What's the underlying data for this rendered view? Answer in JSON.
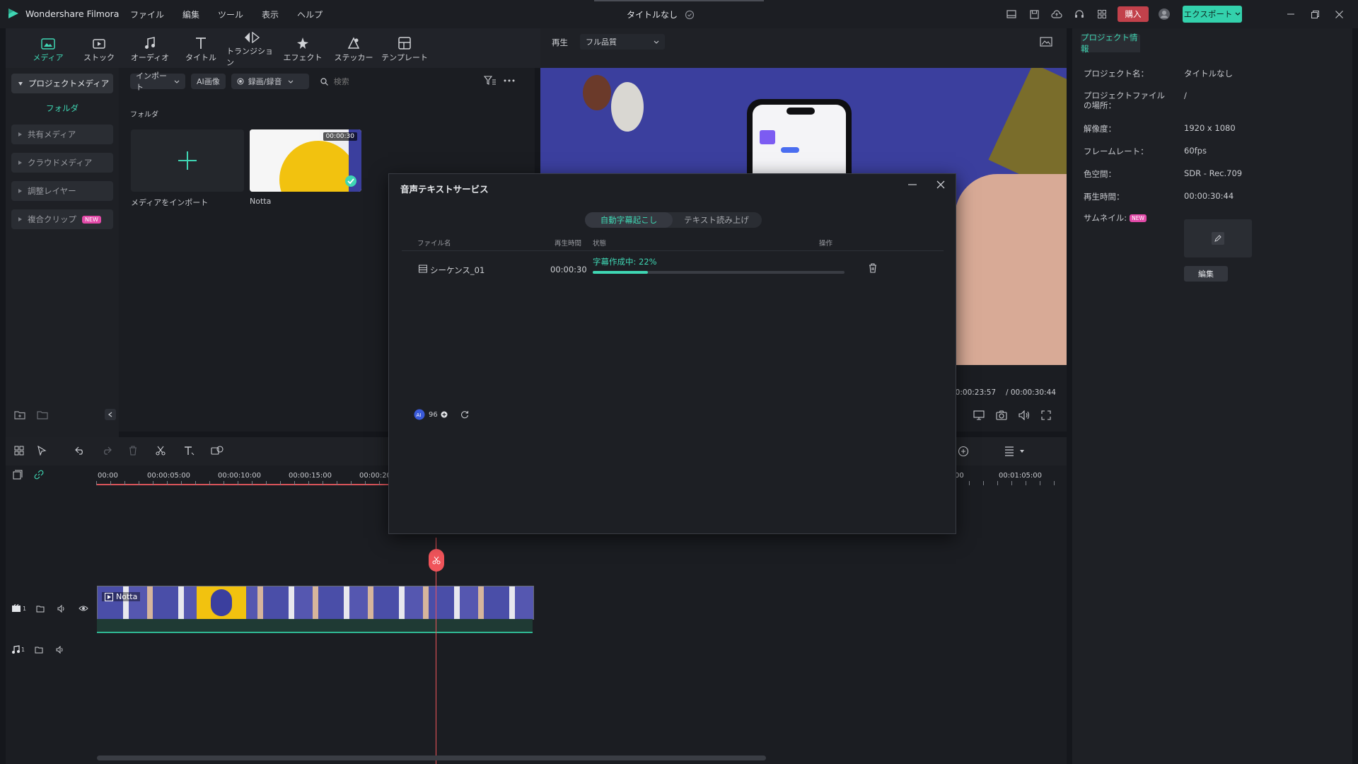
{
  "app": {
    "name": "Wondershare Filmora",
    "project_title": "タイトルなし",
    "menu": [
      "ファイル",
      "編集",
      "ツール",
      "表示",
      "ヘルプ"
    ],
    "buy_label": "購入",
    "export_label": "エクスポート"
  },
  "toolbar_tabs": [
    "メディア",
    "ストック",
    "オーディオ",
    "タイトル",
    "トランジション",
    "エフェクト",
    "ステッカー",
    "テンプレート"
  ],
  "media": {
    "sidebar": {
      "project_media": "プロジェクトメディア",
      "folder": "フォルダ",
      "shared_media": "共有メディア",
      "cloud_media": "クラウドメディア",
      "adjustment_layer": "調整レイヤー",
      "compound_clip": "複合クリップ",
      "new_badge": "NEW"
    },
    "import_label": "インポート",
    "ai_image_label": "AI画像",
    "record_label": "録画/録音",
    "search_placeholder": "検索",
    "folder_header": "フォルダ",
    "import_media_label": "メディアをインポート",
    "clip_name": "Notta",
    "clip_duration": "00:00:30"
  },
  "preview": {
    "play_label": "再生",
    "quality": "フル品質",
    "current_time": "00:00:23:57",
    "total_time": "/ 00:00:30:44"
  },
  "timeline": {
    "ticks": [
      "00:00",
      "00:00:05:00",
      "00:00:10:00",
      "00:00:15:00",
      "00:00:20",
      "00",
      "00:01:05:00"
    ],
    "clip_label": "Notta",
    "video_track_num": "1",
    "audio_track_num": "1"
  },
  "project_info": {
    "tab_label": "プロジェクト情報",
    "rows": [
      {
        "label": "プロジェクト名：",
        "value": "タイトルなし"
      },
      {
        "label": "プロジェクトファイルの場所：",
        "value": "/"
      },
      {
        "label": "解像度：",
        "value": "1920 x 1080"
      },
      {
        "label": "フレームレート：",
        "value": "60fps"
      },
      {
        "label": "色空間：",
        "value": "SDR - Rec.709"
      },
      {
        "label": "再生時間：",
        "value": "00:00:30:44"
      }
    ],
    "thumbnail_label": "サムネイル:",
    "new_badge": "NEW",
    "edit_label": "編集"
  },
  "dialog": {
    "title": "音声テキストサービス",
    "tab_active": "自動字幕起こし",
    "tab_inactive": "テキスト読み上げ",
    "col_filename": "ファイル名",
    "col_duration": "再生時間",
    "col_status": "状態",
    "col_action": "操作",
    "row_filename": "シーケンス_01",
    "row_duration": "00:00:30",
    "row_status": "字幕作成中:  22%",
    "progress": 0.22,
    "credits": "96"
  },
  "colors": {
    "accent": "#3fd6b3",
    "playhead": "#f0545a",
    "buy": "#c2414b",
    "export": "#33d1ac"
  }
}
